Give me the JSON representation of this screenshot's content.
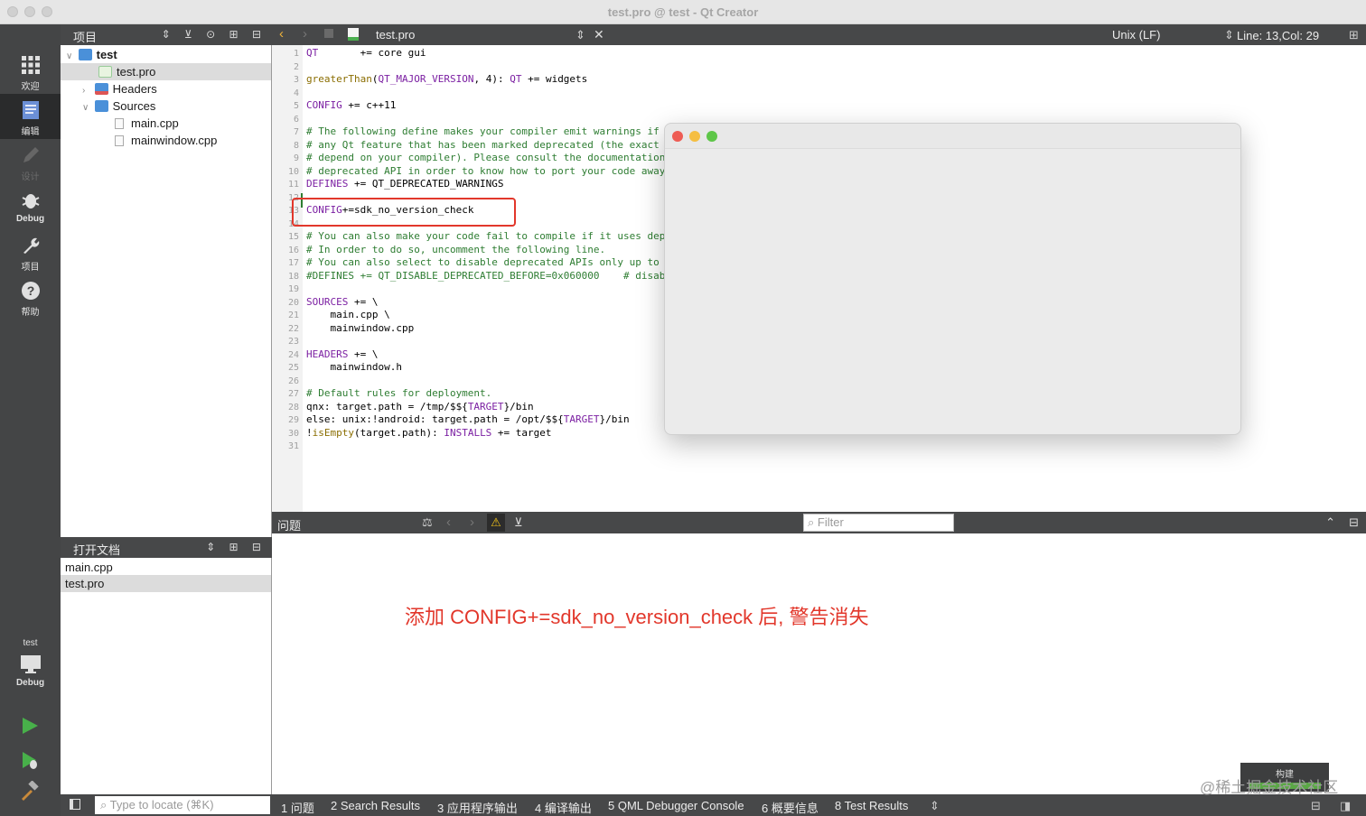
{
  "window": {
    "title": "test.pro @ test - Qt Creator"
  },
  "modes": [
    {
      "label": "欢迎",
      "icon": "grid-icon"
    },
    {
      "label": "编辑",
      "icon": "edit-icon"
    },
    {
      "label": "设计",
      "icon": "pencil-icon"
    },
    {
      "label": "Debug",
      "icon": "bug-icon"
    },
    {
      "label": "项目",
      "icon": "wrench-icon"
    },
    {
      "label": "帮助",
      "icon": "help-icon"
    }
  ],
  "kit": {
    "project": "test",
    "mode": "Debug"
  },
  "project_panel": {
    "title": "项目",
    "items": [
      {
        "label": "test"
      },
      {
        "label": "test.pro"
      },
      {
        "label": "Headers"
      },
      {
        "label": "Sources"
      },
      {
        "label": "main.cpp"
      },
      {
        "label": "mainwindow.cpp"
      }
    ]
  },
  "open_docs": {
    "title": "打开文档",
    "items": [
      "main.cpp",
      "test.pro"
    ]
  },
  "editor": {
    "file": "test.pro",
    "line_ending": "Unix (LF)",
    "position": "Line: 13,Col: 29"
  },
  "code_lines": [
    "QT       += core gui",
    "",
    "greaterThan(QT_MAJOR_VERSION, 4): QT += widgets",
    "",
    "CONFIG += c++11",
    "",
    "# The following define makes your compiler emit warnings if yo",
    "# any Qt feature that has been marked deprecated (the exact wa",
    "# depend on your compiler). Please consult the documentation o",
    "# deprecated API in order to know how to port your code away f",
    "DEFINES += QT_DEPRECATED_WARNINGS",
    "",
    "CONFIG+=sdk_no_version_check",
    "",
    "# You can also make your code fail to compile if it uses depre",
    "# In order to do so, uncomment the following line.",
    "# You can also select to disable deprecated APIs only up to a ",
    "#DEFINES += QT_DISABLE_DEPRECATED_BEFORE=0x060000    # disable",
    "",
    "SOURCES += \\",
    "    main.cpp \\",
    "    mainwindow.cpp",
    "",
    "HEADERS += \\",
    "    mainwindow.h",
    "",
    "# Default rules for deployment.",
    "qnx: target.path = /tmp/$${TARGET}/bin",
    "else: unix:!android: target.path = /opt/$${TARGET}/bin",
    "!isEmpty(target.path): INSTALLS += target",
    ""
  ],
  "issues": {
    "title": "问题",
    "filter_placeholder": "Filter",
    "annotation": "添加 CONFIG+=sdk_no_version_check 后, 警告消失"
  },
  "bottom": {
    "locate_placeholder": "Type to locate (⌘K)",
    "tabs": [
      "1  问题",
      "2  Search Results",
      "3  应用程序输出",
      "4  编译输出",
      "5  QML Debugger Console",
      "6  概要信息",
      "8  Test Results"
    ]
  },
  "build_popup": {
    "label": "构建"
  },
  "watermark": "@稀土掘金技术社区"
}
